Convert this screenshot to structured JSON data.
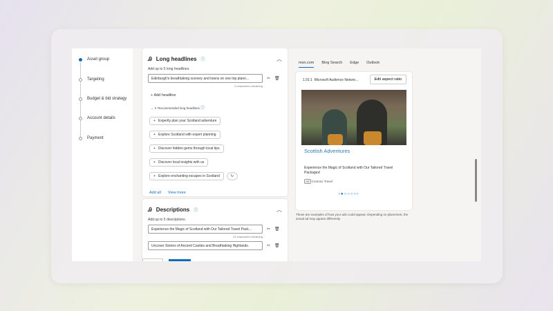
{
  "sidebar": {
    "steps": [
      {
        "label": "Asset group",
        "active": true
      },
      {
        "label": "Targeting"
      },
      {
        "label": "Budget & bid strategy"
      },
      {
        "label": "Account details"
      },
      {
        "label": "Payment"
      }
    ]
  },
  "headlines": {
    "title": "Long headlines",
    "hint": "Add up to 5 long headlines.",
    "value": "Edinburgh's breathtaking scenery and towns on one trip plann...",
    "remaining": "6 characters remaining",
    "add_label": "Add headline",
    "recommended_title": "Recommended long headlines",
    "recommended": [
      "Expertly plan your Scotland adventure",
      "Explore Scotland with expert planning",
      "Discover hidden gems through local tips",
      "Discover local insights with us",
      "Explore enchanting escapes in Scotland"
    ],
    "add_all": "Add all",
    "view_more": "View more"
  },
  "descriptions": {
    "title": "Descriptions",
    "hint": "Add up to 5 descriptions.",
    "values": [
      "Experience the Magic of Scotland with Our Tailored Travel Pack...",
      "Uncover Stories of Ancient Castles and Breathtaking Highlands."
    ],
    "remaining": "23 characters remaining"
  },
  "preview": {
    "tabs": [
      "msn.com",
      "Bing Search",
      "Edge",
      "Outlook"
    ],
    "ratio": "1.91:1",
    "network": "Microsoft Audience Networ...",
    "edit_ratio": "Edit aspect ratio",
    "ad_title": "Scottish Adventures",
    "ad_desc": "Experience the Magic of Scotland with Our Tailored Travel Packages!",
    "ad_badge": "Ad",
    "advertiser": "Contoso Travel",
    "pages": 5,
    "current_page": 1,
    "note": "These are examples of how your ads could appear. Depending on placement, the actual ad may appear differently."
  },
  "colors": {
    "accent": "#0f6cbd"
  }
}
